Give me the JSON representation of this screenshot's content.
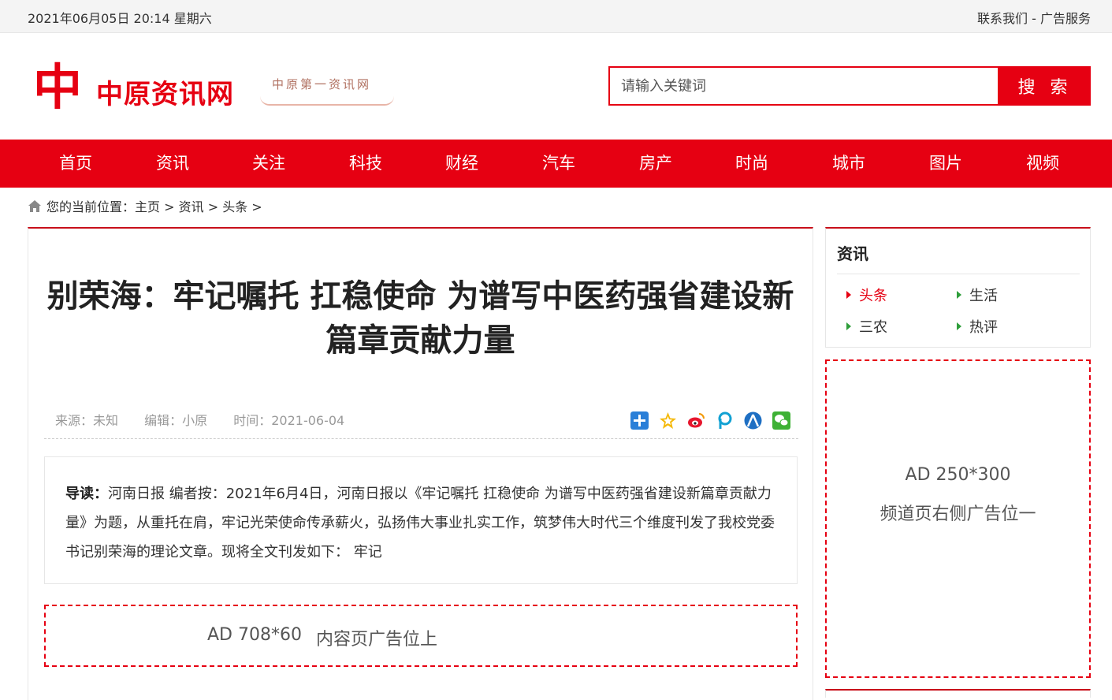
{
  "topbar": {
    "datetime": "2021年06月05日 20:14 星期六",
    "contact": "联系我们",
    "separator": " - ",
    "ads": "广告服务"
  },
  "logo": {
    "mark": "中",
    "name": "中原资讯网",
    "slogan": "中原第一资讯网"
  },
  "search": {
    "placeholder": "请输入关键词",
    "button": "搜 索"
  },
  "nav": {
    "items": [
      "首页",
      "资讯",
      "关注",
      "科技",
      "财经",
      "汽车",
      "房产",
      "时尚",
      "城市",
      "图片",
      "视频"
    ]
  },
  "breadcrumb": {
    "prefix": "您的当前位置：",
    "home": "主页",
    "section": "资讯",
    "sub": "头条",
    "sep": " > "
  },
  "article": {
    "title": "别荣海：牢记嘱托 扛稳使命 为谱写中医药强省建设新篇章贡献力量",
    "source": "来源：未知",
    "editor": "编辑：小原",
    "time": "时间：2021-06-04",
    "summary_label": "导读：",
    "summary_text": "河南日报 编者按：2021年6月4日，河南日报以《牢记嘱托 扛稳使命 为谱写中医药强省建设新篇章贡献力量》为题，从重托在肩，牢记光荣使命传承薪火，弘扬伟大事业扎实工作，筑梦伟大时代三个维度刊发了我校党委书记别荣海的理论文章。现将全文刊发如下： 牢记"
  },
  "ads": {
    "top_size": "AD 708*60",
    "top_label": "内容页广告位上",
    "side_size": "AD 250*300",
    "side_label": "频道页右侧广告位一"
  },
  "sidebar": {
    "title": "资讯",
    "items": [
      "头条",
      "生活",
      "三农",
      "热评"
    ]
  },
  "colors": {
    "brand": "#e60012",
    "bullet": "#2e9e3a"
  }
}
